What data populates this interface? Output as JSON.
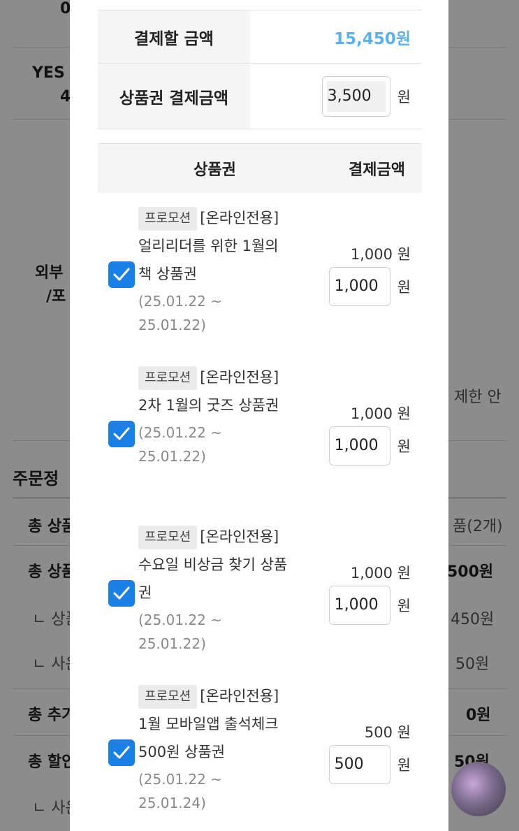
{
  "background": {
    "left_labels": [
      "0",
      "YES",
      "4",
      "외부",
      "/포",
      "주문정",
      "총 상품",
      "총 상품",
      "ㄴ 상품",
      "ㄴ 사은",
      "총 추가",
      "총 할인",
      "ㄴ 사은"
    ],
    "right_values": [
      "제한 안",
      "품(2개)",
      "500원",
      "450원",
      "50원",
      "0원",
      "50원"
    ]
  },
  "summary": {
    "total_label": "결제할 금액",
    "total_value": "15,450원",
    "voucher_total_label": "상품권 결제금액",
    "voucher_total_value": "3,500",
    "unit": "원"
  },
  "voucher_table": {
    "col_voucher": "상품권",
    "col_amount": "결제금액",
    "items": [
      {
        "tag": "프로모션",
        "name": "[온라인전용] 얼리리더를 위한 1월의 책 상품권",
        "period": "(25.01.22 ~ 25.01.22)",
        "amount": "1,000 원",
        "input": "1,000",
        "unit": "원",
        "checked": true
      },
      {
        "tag": "프로모션",
        "name": "[온라인전용] 2차 1월의 굿즈 상품권",
        "period": "(25.01.22 ~ 25.01.22)",
        "amount": "1,000 원",
        "input": "1,000",
        "unit": "원",
        "checked": true
      },
      {
        "tag": "프로모션",
        "name": "[온라인전용] 수요일 비상금 찾기 상품권",
        "period": "(25.01.22 ~ 25.01.22)",
        "amount": "1,000 원",
        "input": "1,000",
        "unit": "원",
        "checked": true
      },
      {
        "tag": "프로모션",
        "name": "[온라인전용] 1월 모바일앱 출석체크 500원 상품권",
        "period": "(25.01.22 ~ 25.01.24)",
        "amount": "500 원",
        "input": "500",
        "unit": "원",
        "checked": true
      }
    ]
  },
  "colors": {
    "accent": "#5fb1e5",
    "checkbox": "#1a7fe6"
  }
}
